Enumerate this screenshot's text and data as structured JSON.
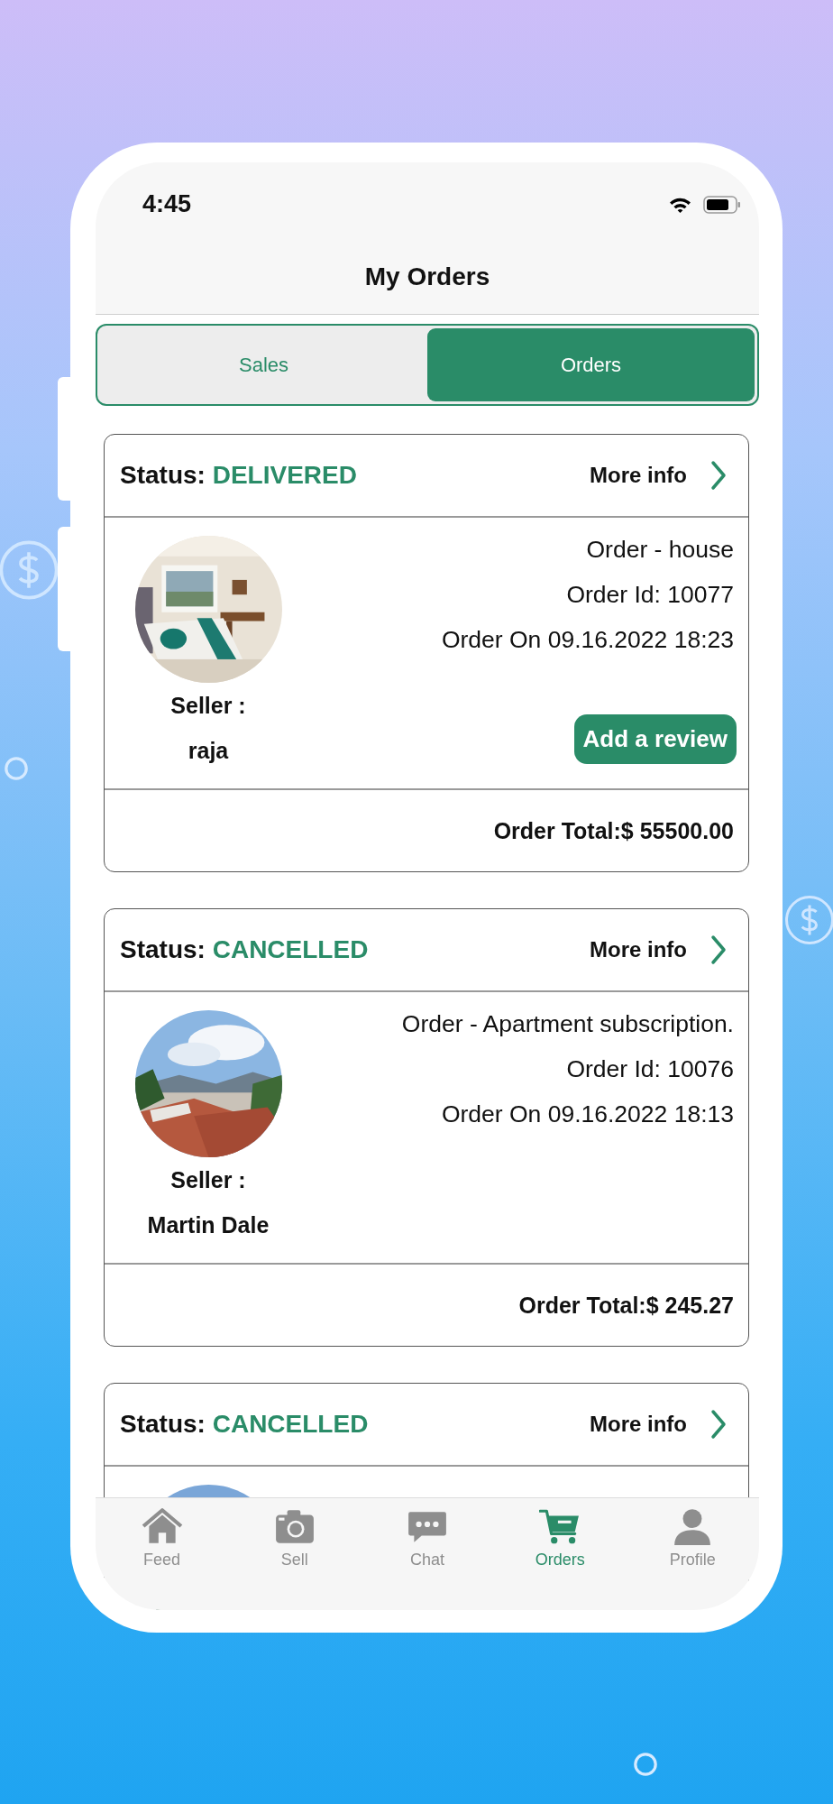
{
  "status_bar": {
    "time": "4:45"
  },
  "header": {
    "title": "My Orders"
  },
  "segments": [
    {
      "label": "Sales",
      "selected": false
    },
    {
      "label": "Orders",
      "selected": true
    }
  ],
  "orders": [
    {
      "status_label": "Status:",
      "status": "DELIVERED",
      "more_info": "More info",
      "title": "Order - house",
      "order_id": "Order Id: 10077",
      "order_on": "Order On 09.16.2022 18:23",
      "seller_label": "Seller :",
      "seller": "raja",
      "action": "Add a review",
      "total": "Order Total:$ 55500.00"
    },
    {
      "status_label": "Status:",
      "status": "CANCELLED",
      "more_info": "More info",
      "title": "Order - Apartment subscription.",
      "order_id": "Order Id: 10076",
      "order_on": "Order On 09.16.2022 18:13",
      "seller_label": "Seller :",
      "seller": "Martin Dale",
      "total": "Order Total:$ 245.27"
    },
    {
      "status_label": "Status:",
      "status": "CANCELLED",
      "more_info": "More info"
    }
  ],
  "tab_bar": [
    {
      "label": "Feed",
      "kind": "home",
      "selected": false
    },
    {
      "label": "Sell",
      "kind": "camera",
      "selected": false
    },
    {
      "label": "Chat",
      "kind": "chat",
      "selected": false
    },
    {
      "label": "Orders",
      "kind": "cart",
      "selected": true
    },
    {
      "label": "Profile",
      "kind": "person",
      "selected": false
    }
  ]
}
